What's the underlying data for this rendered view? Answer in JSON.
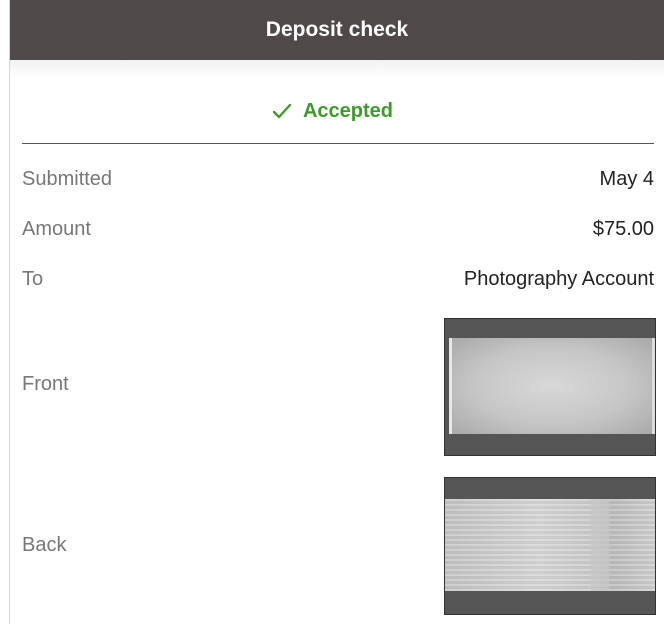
{
  "header": {
    "title": "Deposit check"
  },
  "status": {
    "icon": "check-icon",
    "text": "Accepted",
    "color": "#3f9a2c"
  },
  "details": {
    "submitted": {
      "label": "Submitted",
      "value": "May 4"
    },
    "amount": {
      "label": "Amount",
      "value": "$75.00"
    },
    "to": {
      "label": "To",
      "value": "Photography Account"
    },
    "front": {
      "label": "Front",
      "image": "check-front-image"
    },
    "back": {
      "label": "Back",
      "image": "check-back-image"
    }
  }
}
